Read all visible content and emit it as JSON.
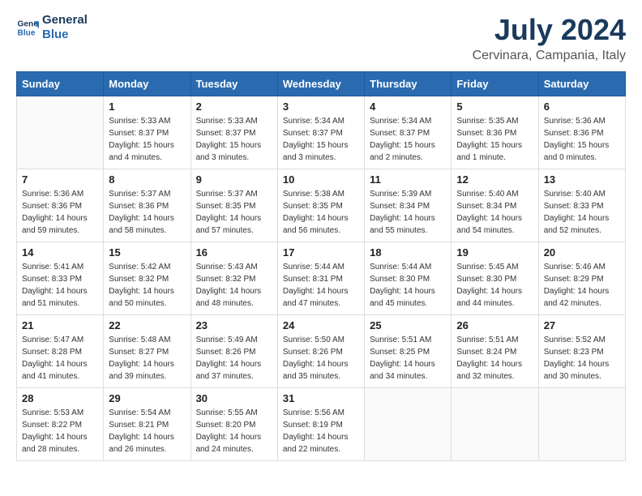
{
  "logo": {
    "line1": "General",
    "line2": "Blue"
  },
  "title": "July 2024",
  "subtitle": "Cervinara, Campania, Italy",
  "headers": [
    "Sunday",
    "Monday",
    "Tuesday",
    "Wednesday",
    "Thursday",
    "Friday",
    "Saturday"
  ],
  "weeks": [
    [
      {
        "day": "",
        "info": ""
      },
      {
        "day": "1",
        "info": "Sunrise: 5:33 AM\nSunset: 8:37 PM\nDaylight: 15 hours\nand 4 minutes."
      },
      {
        "day": "2",
        "info": "Sunrise: 5:33 AM\nSunset: 8:37 PM\nDaylight: 15 hours\nand 3 minutes."
      },
      {
        "day": "3",
        "info": "Sunrise: 5:34 AM\nSunset: 8:37 PM\nDaylight: 15 hours\nand 3 minutes."
      },
      {
        "day": "4",
        "info": "Sunrise: 5:34 AM\nSunset: 8:37 PM\nDaylight: 15 hours\nand 2 minutes."
      },
      {
        "day": "5",
        "info": "Sunrise: 5:35 AM\nSunset: 8:36 PM\nDaylight: 15 hours\nand 1 minute."
      },
      {
        "day": "6",
        "info": "Sunrise: 5:36 AM\nSunset: 8:36 PM\nDaylight: 15 hours\nand 0 minutes."
      }
    ],
    [
      {
        "day": "7",
        "info": "Sunrise: 5:36 AM\nSunset: 8:36 PM\nDaylight: 14 hours\nand 59 minutes."
      },
      {
        "day": "8",
        "info": "Sunrise: 5:37 AM\nSunset: 8:36 PM\nDaylight: 14 hours\nand 58 minutes."
      },
      {
        "day": "9",
        "info": "Sunrise: 5:37 AM\nSunset: 8:35 PM\nDaylight: 14 hours\nand 57 minutes."
      },
      {
        "day": "10",
        "info": "Sunrise: 5:38 AM\nSunset: 8:35 PM\nDaylight: 14 hours\nand 56 minutes."
      },
      {
        "day": "11",
        "info": "Sunrise: 5:39 AM\nSunset: 8:34 PM\nDaylight: 14 hours\nand 55 minutes."
      },
      {
        "day": "12",
        "info": "Sunrise: 5:40 AM\nSunset: 8:34 PM\nDaylight: 14 hours\nand 54 minutes."
      },
      {
        "day": "13",
        "info": "Sunrise: 5:40 AM\nSunset: 8:33 PM\nDaylight: 14 hours\nand 52 minutes."
      }
    ],
    [
      {
        "day": "14",
        "info": "Sunrise: 5:41 AM\nSunset: 8:33 PM\nDaylight: 14 hours\nand 51 minutes."
      },
      {
        "day": "15",
        "info": "Sunrise: 5:42 AM\nSunset: 8:32 PM\nDaylight: 14 hours\nand 50 minutes."
      },
      {
        "day": "16",
        "info": "Sunrise: 5:43 AM\nSunset: 8:32 PM\nDaylight: 14 hours\nand 48 minutes."
      },
      {
        "day": "17",
        "info": "Sunrise: 5:44 AM\nSunset: 8:31 PM\nDaylight: 14 hours\nand 47 minutes."
      },
      {
        "day": "18",
        "info": "Sunrise: 5:44 AM\nSunset: 8:30 PM\nDaylight: 14 hours\nand 45 minutes."
      },
      {
        "day": "19",
        "info": "Sunrise: 5:45 AM\nSunset: 8:30 PM\nDaylight: 14 hours\nand 44 minutes."
      },
      {
        "day": "20",
        "info": "Sunrise: 5:46 AM\nSunset: 8:29 PM\nDaylight: 14 hours\nand 42 minutes."
      }
    ],
    [
      {
        "day": "21",
        "info": "Sunrise: 5:47 AM\nSunset: 8:28 PM\nDaylight: 14 hours\nand 41 minutes."
      },
      {
        "day": "22",
        "info": "Sunrise: 5:48 AM\nSunset: 8:27 PM\nDaylight: 14 hours\nand 39 minutes."
      },
      {
        "day": "23",
        "info": "Sunrise: 5:49 AM\nSunset: 8:26 PM\nDaylight: 14 hours\nand 37 minutes."
      },
      {
        "day": "24",
        "info": "Sunrise: 5:50 AM\nSunset: 8:26 PM\nDaylight: 14 hours\nand 35 minutes."
      },
      {
        "day": "25",
        "info": "Sunrise: 5:51 AM\nSunset: 8:25 PM\nDaylight: 14 hours\nand 34 minutes."
      },
      {
        "day": "26",
        "info": "Sunrise: 5:51 AM\nSunset: 8:24 PM\nDaylight: 14 hours\nand 32 minutes."
      },
      {
        "day": "27",
        "info": "Sunrise: 5:52 AM\nSunset: 8:23 PM\nDaylight: 14 hours\nand 30 minutes."
      }
    ],
    [
      {
        "day": "28",
        "info": "Sunrise: 5:53 AM\nSunset: 8:22 PM\nDaylight: 14 hours\nand 28 minutes."
      },
      {
        "day": "29",
        "info": "Sunrise: 5:54 AM\nSunset: 8:21 PM\nDaylight: 14 hours\nand 26 minutes."
      },
      {
        "day": "30",
        "info": "Sunrise: 5:55 AM\nSunset: 8:20 PM\nDaylight: 14 hours\nand 24 minutes."
      },
      {
        "day": "31",
        "info": "Sunrise: 5:56 AM\nSunset: 8:19 PM\nDaylight: 14 hours\nand 22 minutes."
      },
      {
        "day": "",
        "info": ""
      },
      {
        "day": "",
        "info": ""
      },
      {
        "day": "",
        "info": ""
      }
    ]
  ]
}
